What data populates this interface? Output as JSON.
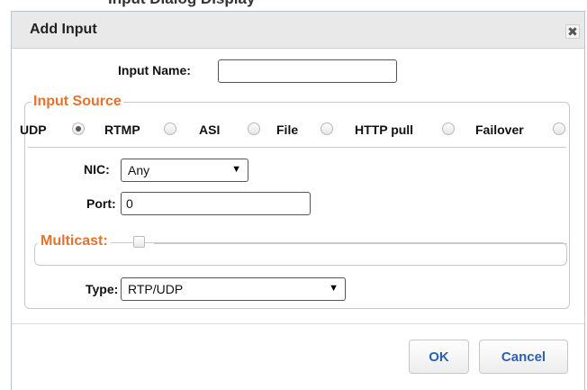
{
  "page": {
    "background_heading": "Input Dialog Display"
  },
  "dialog": {
    "title": "Add Input",
    "close_glyph": "✖"
  },
  "input_name": {
    "label": "Input Name:",
    "value": ""
  },
  "input_source": {
    "legend": "Input Source",
    "accent_color": "#e8722c",
    "options": [
      {
        "label": "UDP",
        "selected": true
      },
      {
        "label": "RTMP",
        "selected": false
      },
      {
        "label": "ASI",
        "selected": false
      },
      {
        "label": "File",
        "selected": false
      },
      {
        "label": "HTTP pull",
        "selected": false
      },
      {
        "label": "Failover",
        "selected": false
      }
    ]
  },
  "nic": {
    "label": "NIC:",
    "value": "Any"
  },
  "port": {
    "label": "Port:",
    "value": "0"
  },
  "multicast": {
    "label": "Multicast:",
    "checked": false
  },
  "type": {
    "label": "Type:",
    "value": "RTP/UDP"
  },
  "buttons": {
    "ok": "OK",
    "cancel": "Cancel",
    "text_color": "#2a62b5"
  },
  "icons": {
    "dropdown_arrow": "▼"
  }
}
